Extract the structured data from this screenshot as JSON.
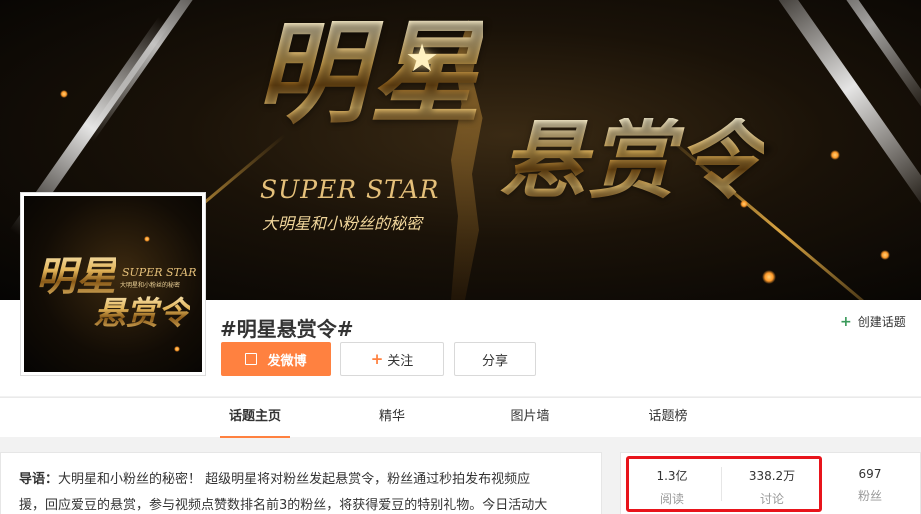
{
  "banner": {
    "title_line1": "明星",
    "title_line2": "悬赏令",
    "subtitle_en": "SUPER STAR",
    "subtitle_cn": "大明星和小粉丝的秘密"
  },
  "avatar": {
    "title_line1": "明星",
    "title_line2": "悬赏令",
    "subtitle_en": "SUPER STAR",
    "subtitle_cn": "大明星和小粉丝的秘密"
  },
  "header": {
    "topic_title": "#明星悬赏令#",
    "create_topic": "创建话题",
    "post_button": "发微博",
    "follow_button": "关注",
    "share_button": "分享"
  },
  "tabs": [
    {
      "label": "话题主页",
      "active": true
    },
    {
      "label": "精华",
      "active": false
    },
    {
      "label": "图片墙",
      "active": false
    },
    {
      "label": "话题榜",
      "active": false
    }
  ],
  "intro": {
    "lead": "导语：",
    "line1": "大明星和小粉丝的秘密！ 超级明星将对粉丝发起悬赏令，粉丝通过秒拍发布视频应",
    "line2": "援，回应爱豆的悬赏，参与视频点赞数排名前3的粉丝，将获得爱豆的特别礼物。今日活动大"
  },
  "stats": [
    {
      "value": "1.3亿",
      "label": "阅读"
    },
    {
      "value": "338.2万",
      "label": "讨论"
    },
    {
      "value": "697",
      "label": "粉丝"
    }
  ],
  "colors": {
    "accent": "#ff8140",
    "highlight": "#e8141b",
    "green_plus": "#3a9a5a"
  }
}
